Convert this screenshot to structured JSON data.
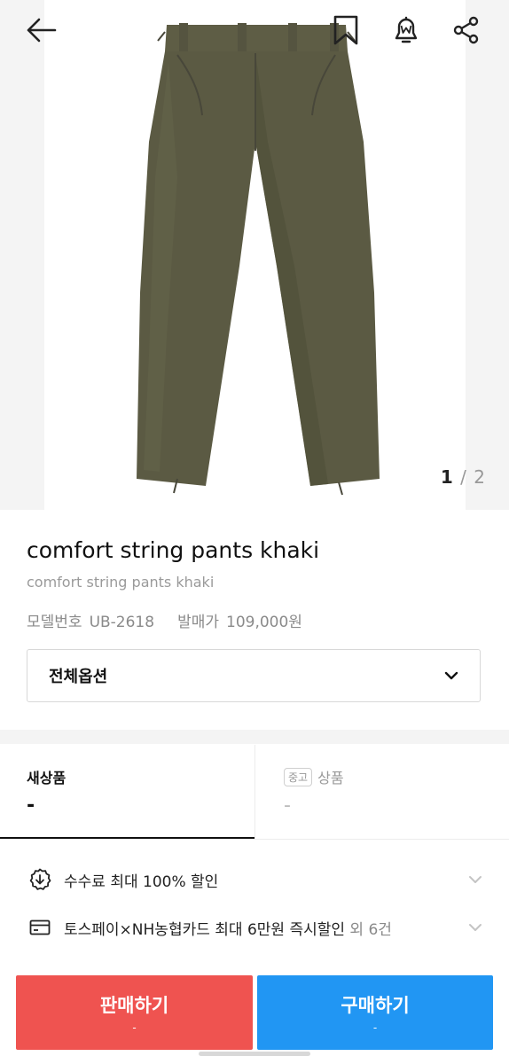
{
  "header": {
    "back_icon": "arrow-left-icon",
    "bookmark_icon": "bookmark-icon",
    "alert_icon": "bell-w-icon",
    "share_icon": "share-icon"
  },
  "gallery": {
    "current": "1",
    "separator": "/",
    "total": "2",
    "product_color": "#5b5a43"
  },
  "product": {
    "title": "comfort string pants khaki",
    "subtitle": "comfort string pants khaki",
    "model_label": "모델번호",
    "model_value": "UB-2618",
    "release_label": "발매가",
    "release_value": "109,000원"
  },
  "options": {
    "label": "전체옵션"
  },
  "tabs": {
    "new_label": "새상품",
    "new_price": "-",
    "used_badge": "중고",
    "used_label": "상품",
    "used_price": "-"
  },
  "benefits": [
    {
      "icon": "discount-download-icon",
      "text": "수수료 최대 100% 할인",
      "extra": ""
    },
    {
      "icon": "card-icon",
      "text": "토스페이×NH농협카드 최대 6만원 즉시할인",
      "extra": " 외 6건"
    }
  ],
  "actions": {
    "sell_label": "판매하기",
    "sell_sub": "-",
    "buy_label": "구매하기",
    "buy_sub": "-",
    "sell_color": "#ef5350",
    "buy_color": "#2196f3"
  }
}
